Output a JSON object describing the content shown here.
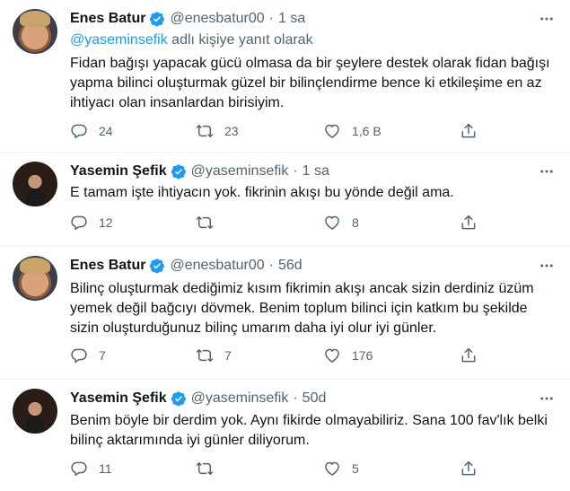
{
  "tweets": [
    {
      "name": "Enes Batur",
      "handle": "@enesbatur00",
      "sep": "·",
      "time": "1 sa",
      "reply_prefix": "@yaseminsefik",
      "reply_suffix": " adlı kişiye yanıt olarak",
      "lines": [
        "Fidan bağışı yapacak gücü olmasa da bir şeylere destek olarak fidan bağışı",
        "yapma bilinci oluşturmak güzel bir bilinçlendirme bence ki etkileşime en az",
        "ihtiyacı olan insanlardan birisiyim."
      ],
      "replies": "24",
      "retweets": "23",
      "likes": "1,6 B"
    },
    {
      "name": "Yasemin Şefik",
      "handle": "@yaseminsefik",
      "sep": "·",
      "time": "1 sa",
      "lines": [
        "E tamam işte ihtiyacın yok. fikrinin akışı bu yönde değil ama."
      ],
      "replies": "12",
      "retweets": "",
      "likes": "8"
    },
    {
      "name": "Enes Batur",
      "handle": "@enesbatur00",
      "sep": "·",
      "time": "56d",
      "lines": [
        "Bilinç oluşturmak dediğimiz kısım fikrimin akışı ancak sizin derdiniz üzüm",
        "yemek değil bağcıyı dövmek. Benim toplum bilinci için katkım bu şekilde",
        "sizin oluşturduğunuz bilinç umarım daha iyi olur iyi günler."
      ],
      "replies": "7",
      "retweets": "7",
      "likes": "176"
    },
    {
      "name": "Yasemin Şefik",
      "handle": "@yaseminsefik",
      "sep": "·",
      "time": "50d",
      "lines": [
        "Benim böyle bir derdim yok. Aynı fikirde olmayabiliriz. Sana 100 fav'lık belki",
        "bilinç aktarımında  iyi günler diliyorum."
      ],
      "replies": "11",
      "retweets": "",
      "likes": "5"
    }
  ],
  "icons": {
    "verified": "verified-badge-icon",
    "more": "more-icon",
    "reply": "reply-icon",
    "retweet": "retweet-icon",
    "like": "like-icon",
    "share": "share-icon"
  },
  "colors": {
    "accent": "#1d9bf0",
    "secondary_text": "#536471",
    "primary_text": "#0f1419"
  }
}
